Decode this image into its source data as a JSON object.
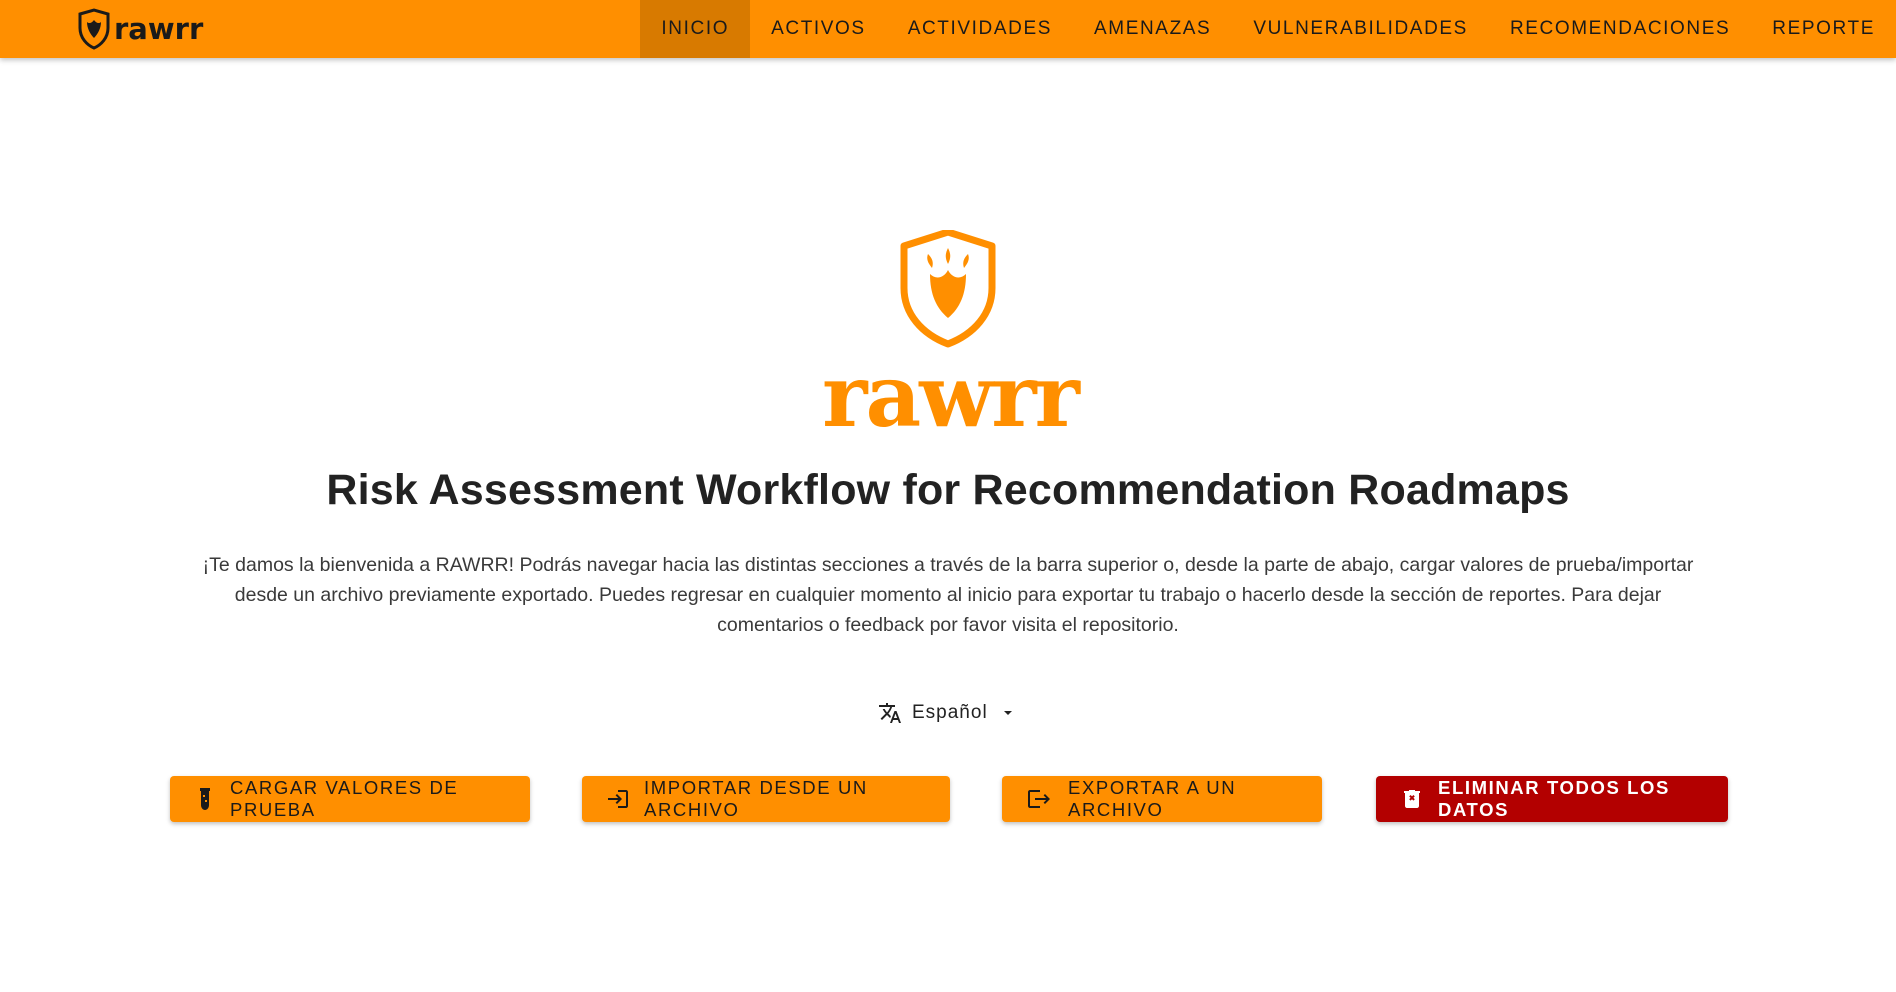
{
  "header": {
    "brand_logo": "rawrr-logo",
    "nav": [
      {
        "label": "INICIO",
        "active": true
      },
      {
        "label": "ACTIVOS",
        "active": false
      },
      {
        "label": "ACTIVIDADES",
        "active": false
      },
      {
        "label": "AMENAZAS",
        "active": false
      },
      {
        "label": "VULNERABILIDADES",
        "active": false
      },
      {
        "label": "RECOMENDACIONES",
        "active": false
      },
      {
        "label": "REPORTE",
        "active": false
      }
    ]
  },
  "main": {
    "hero_logo": "rawrr-shield-logo",
    "title": "Risk Assessment Workflow for Recommendation Roadmaps",
    "intro": "¡Te damos la bienvenida a RAWRR! Podrás navegar hacia las distintas secciones a través de la barra superior o, desde la parte de abajo, cargar valores de prueba/importar desde un archivo previamente exportado. Puedes regresar en cualquier momento al inicio para exportar tu trabajo o hacerlo desde la sección de reportes. Para dejar comentarios o feedback por favor visita el repositorio.",
    "language": {
      "icon": "translate-icon",
      "selected": "Español"
    },
    "actions": {
      "load_sample": "CARGAR VALORES DE PRUEBA",
      "import_file": "IMPORTAR DESDE UN ARCHIVO",
      "export_file": "EXPORTAR A UN ARCHIVO",
      "delete_all": "ELIMINAR TODOS LOS DATOS"
    }
  },
  "colors": {
    "primary": "#ff8f00",
    "nav_active": "#d87a00",
    "danger": "#b30000",
    "text": "#222222"
  }
}
